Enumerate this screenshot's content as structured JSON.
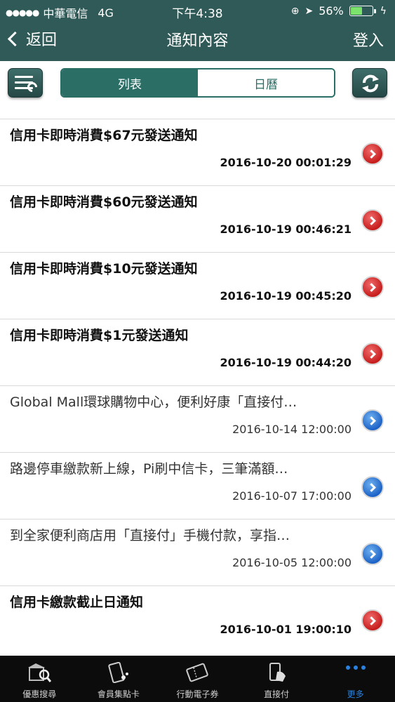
{
  "status_bar": {
    "carrier": "中華電信",
    "network": "4G",
    "time": "下午4:38",
    "battery_percent": "56%",
    "battery_level": 0.56
  },
  "nav": {
    "back_label": "返回",
    "title": "通知內容",
    "login_label": "登入"
  },
  "segments": {
    "list_label": "列表",
    "calendar_label": "日曆",
    "selected": "列表"
  },
  "notifications": [
    {
      "title": "信用卡即時消費$67元發送通知",
      "time": "2016-10-20 00:01:29",
      "style": "bold",
      "icon": "red-arrow-icon"
    },
    {
      "title": "信用卡即時消費$60元發送通知",
      "time": "2016-10-19 00:46:21",
      "style": "bold",
      "icon": "red-arrow-icon"
    },
    {
      "title": "信用卡即時消費$10元發送通知",
      "time": "2016-10-19 00:45:20",
      "style": "bold",
      "icon": "red-arrow-icon"
    },
    {
      "title": "信用卡即時消費$1元發送通知",
      "time": "2016-10-19 00:44:20",
      "style": "bold",
      "icon": "red-arrow-icon"
    },
    {
      "title": "Global Mall環球購物中心，便利好康「直接付…",
      "time": "2016-10-14 12:00:00",
      "style": "normal",
      "icon": "blue-arrow-icon"
    },
    {
      "title": "路邊停車繳款新上線，Pi刷中信卡，三筆滿額…",
      "time": "2016-10-07 17:00:00",
      "style": "normal",
      "icon": "blue-arrow-icon"
    },
    {
      "title": "到全家便利商店用「直接付」手機付款，享指…",
      "time": "2016-10-05 12:00:00",
      "style": "normal",
      "icon": "blue-arrow-icon"
    },
    {
      "title": "信用卡繳款截止日通知",
      "time": "2016-10-01 19:00:10",
      "style": "bold",
      "icon": "red-arrow-icon"
    }
  ],
  "tabbar": {
    "tabs": [
      {
        "label": "優惠搜尋",
        "icon": "store-search-icon"
      },
      {
        "label": "會員集點卡",
        "icon": "phone-card-icon"
      },
      {
        "label": "行動電子券",
        "icon": "ticket-icon"
      },
      {
        "label": "直接付",
        "icon": "phone-pay-icon"
      },
      {
        "label": "更多",
        "icon": "more-dots-icon"
      }
    ],
    "active": "更多"
  },
  "colors": {
    "header_bg": "#2f5a57",
    "accent": "#2a6e66",
    "red_arrow": "#d32a2a",
    "blue_arrow": "#2a6fd3",
    "tab_active": "#2a82e0"
  }
}
